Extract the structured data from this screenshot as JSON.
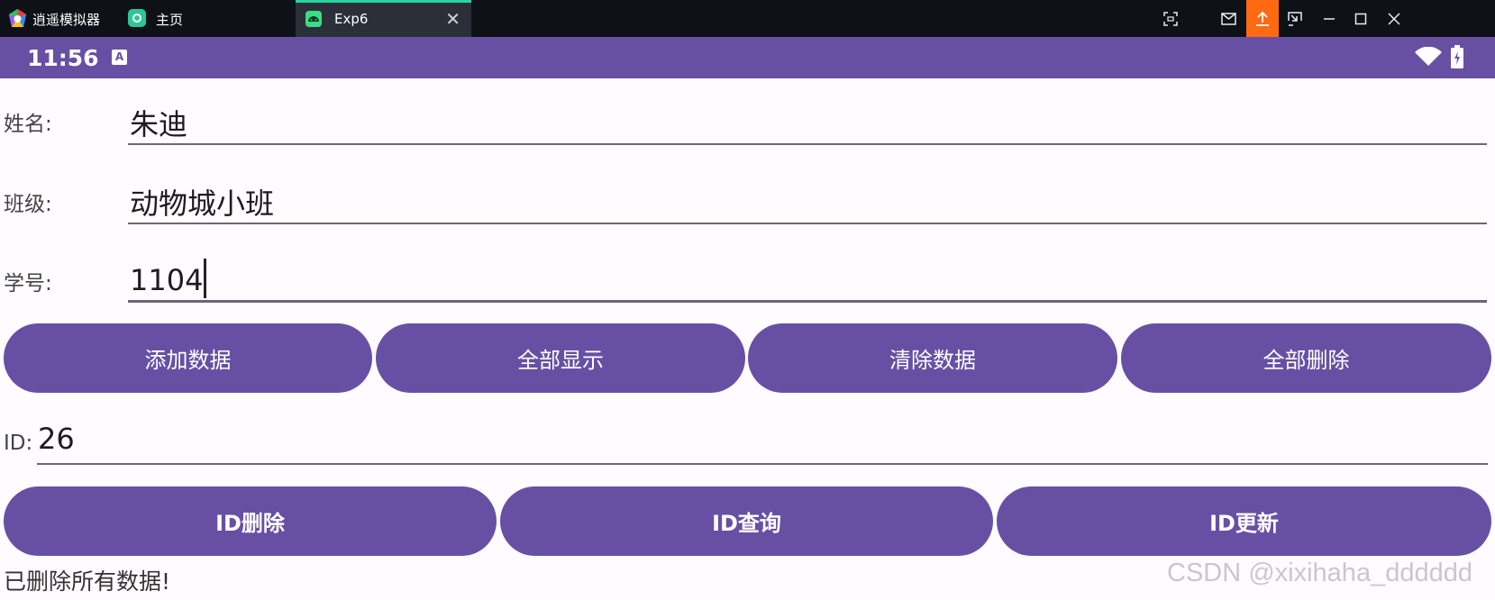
{
  "emulator": {
    "app_name": "逍遥模拟器",
    "tabs": [
      {
        "label": "主页"
      },
      {
        "label": "Exp6",
        "close": "✕"
      }
    ],
    "controls": [
      "fullscreen-icon",
      "mail-icon",
      "upload-icon",
      "screencast-icon",
      "minimize-icon",
      "maximize-icon",
      "close-icon"
    ],
    "colors": {
      "bar": "#0e1117",
      "active_tab": "#2b3038",
      "upload": "#ff6a13",
      "tab_accent": "#2bd3a0"
    }
  },
  "status_bar": {
    "time": "11:56",
    "notification_icon": "A",
    "color": "#6750a4"
  },
  "form": {
    "name": {
      "label": "姓名:",
      "value": "朱迪"
    },
    "class": {
      "label": "班级:",
      "value": "动物城小班"
    },
    "student_id": {
      "label": "学号:",
      "value": "1104"
    }
  },
  "buttons_row1": [
    {
      "label": "添加数据"
    },
    {
      "label": "全部显示"
    },
    {
      "label": "清除数据"
    },
    {
      "label": "全部删除"
    }
  ],
  "id_field": {
    "label": "ID:",
    "value": "26"
  },
  "buttons_row2": [
    {
      "label": "ID删除"
    },
    {
      "label": "ID查询"
    },
    {
      "label": "ID更新"
    }
  ],
  "message": "已删除所有数据!",
  "watermark": "CSDN @xixihaha_dddddd",
  "accent_color": "#6750a4"
}
